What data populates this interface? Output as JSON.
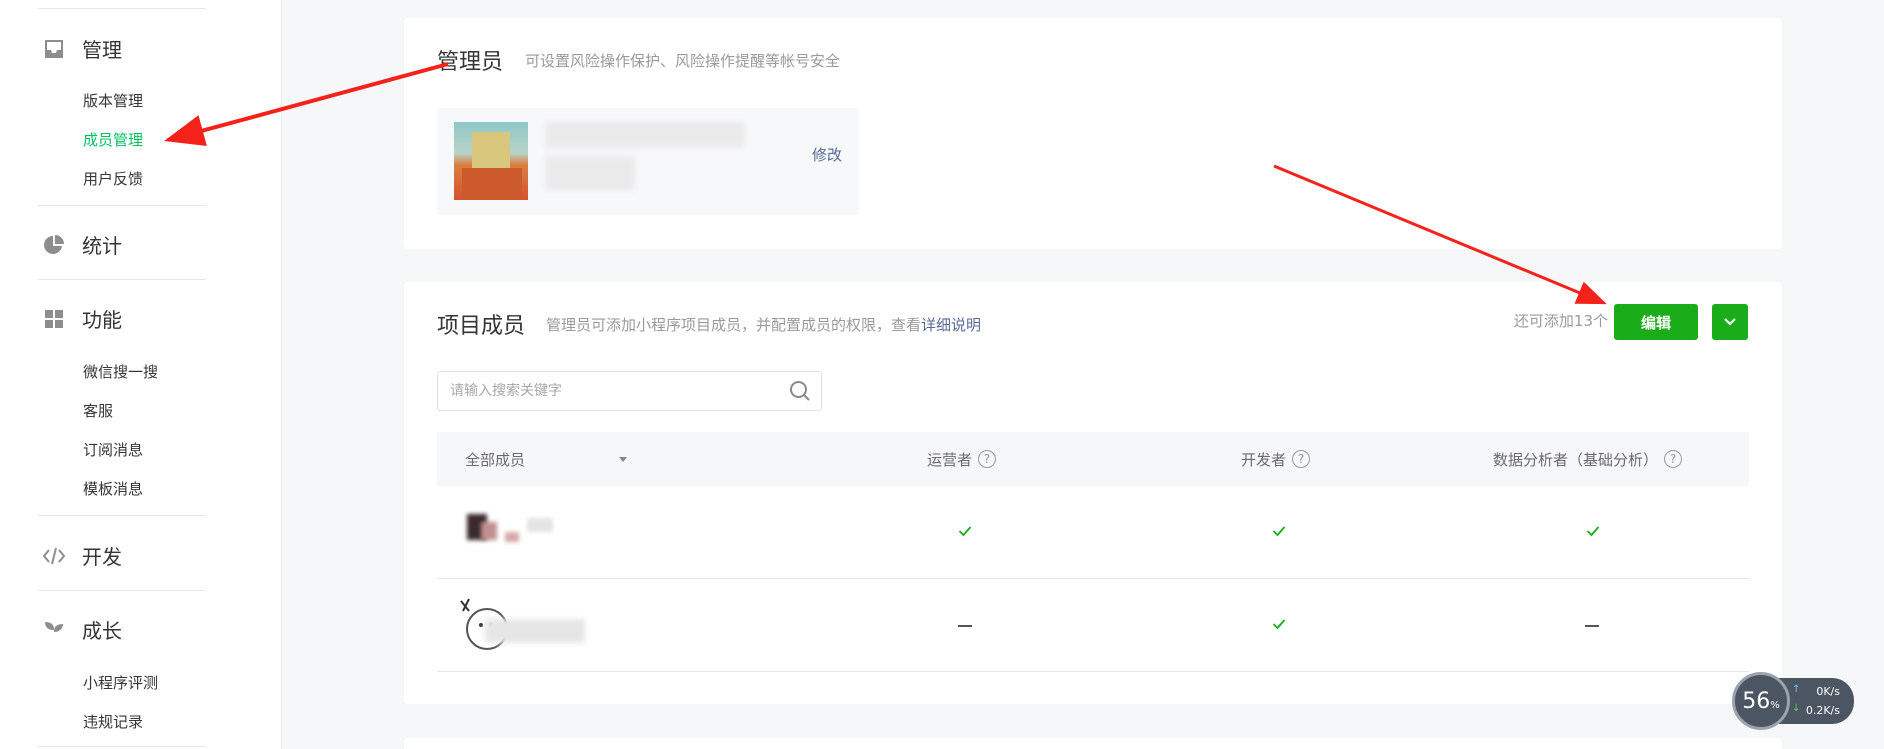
{
  "sidebar": {
    "groups": [
      {
        "label": "管理",
        "icon": "inbox-icon"
      },
      {
        "label": "统计",
        "icon": "pie-chart-icon"
      },
      {
        "label": "功能",
        "icon": "grid-icon"
      },
      {
        "label": "开发",
        "icon": "code-icon"
      },
      {
        "label": "成长",
        "icon": "sprout-icon"
      }
    ],
    "manage_items": [
      "版本管理",
      "成员管理",
      "用户反馈"
    ],
    "feature_items": [
      "微信搜一搜",
      "客服",
      "订阅消息",
      "模板消息"
    ],
    "growth_items": [
      "小程序评测",
      "违规记录"
    ],
    "active_color": "#07c160"
  },
  "admin": {
    "title": "管理员",
    "desc": "可设置风险操作保护、风险操作提醒等帐号安全",
    "edit_label": "修改"
  },
  "members": {
    "title": "项目成员",
    "desc": "管理员可添加小程序项目成员，并配置成员的权限，查看",
    "desc_link": "详细说明",
    "quota": "还可添加13个",
    "edit_button": "编辑",
    "search_placeholder": "请输入搜索关键字",
    "columns": [
      "全部成员",
      "运营者",
      "开发者",
      "数据分析者（基础分析）"
    ],
    "rows": [
      {
        "operator": "check",
        "developer": "check",
        "analyst": "check"
      },
      {
        "operator": "dash",
        "developer": "check",
        "analyst": "dash"
      }
    ],
    "accent": "#1aad19"
  },
  "speed_widget": {
    "percent": "56",
    "percent_sign": "%",
    "upload": "0K/s",
    "download": "0.2K/s"
  }
}
